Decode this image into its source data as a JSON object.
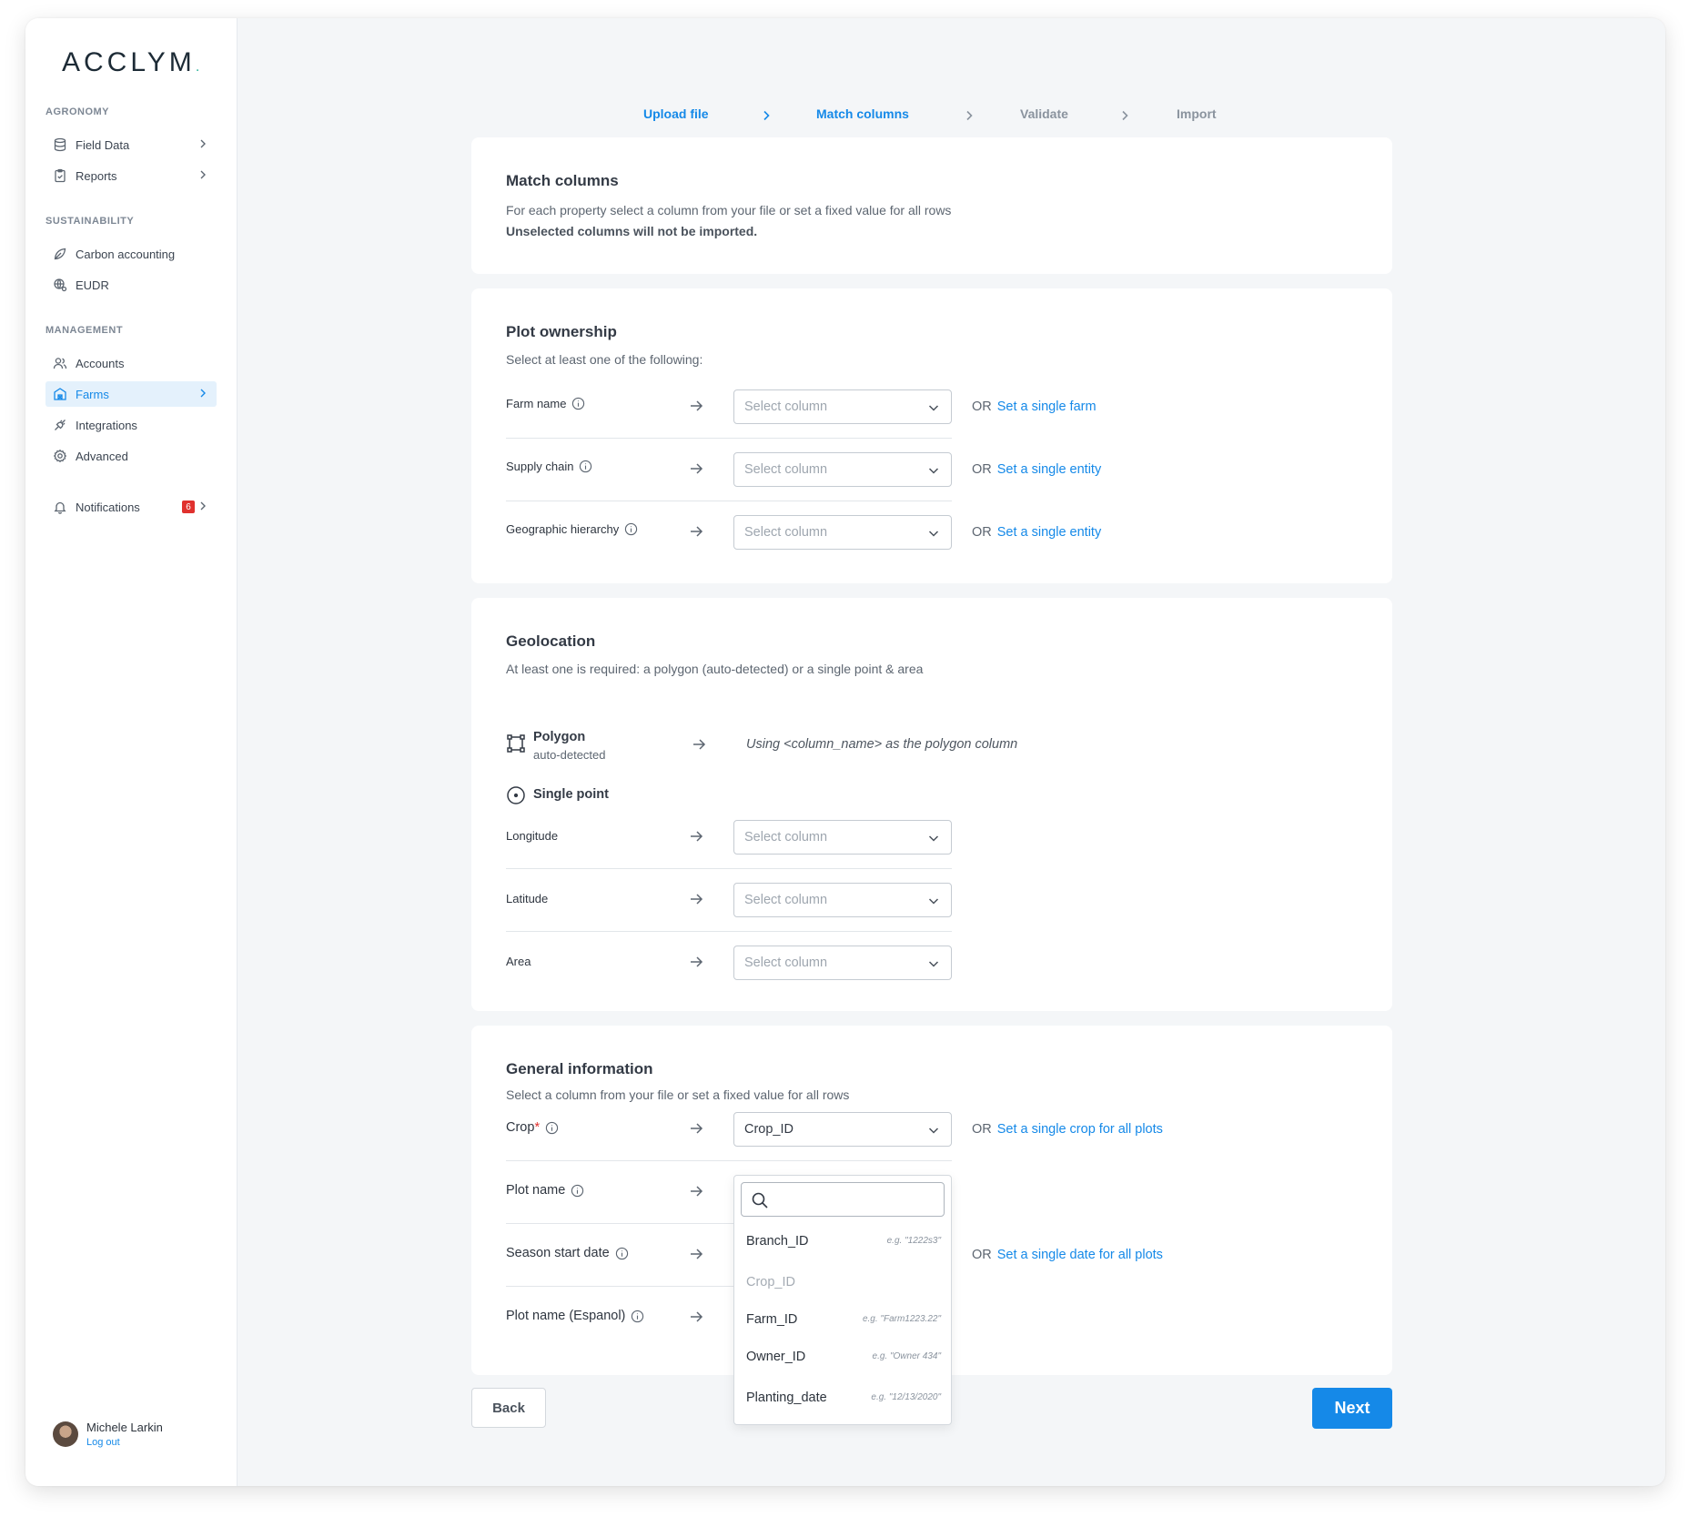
{
  "app": {
    "logo": "ACCLYM",
    "logo_dot": "."
  },
  "sidebar": {
    "sections": [
      {
        "title": "AGRONOMY"
      },
      {
        "title": "SUSTAINABILITY"
      },
      {
        "title": "MANAGEMENT"
      }
    ],
    "items": [
      {
        "label": "Field Data",
        "icon": "database-icon"
      },
      {
        "label": "Reports",
        "icon": "clipboard-icon"
      },
      {
        "label": "Carbon accounting",
        "icon": "leaf-icon"
      },
      {
        "label": "EUDR",
        "icon": "globe-icon"
      },
      {
        "label": "Accounts",
        "icon": "users-icon"
      },
      {
        "label": "Farms",
        "icon": "farm-icon",
        "active": true
      },
      {
        "label": "Integrations",
        "icon": "plug-icon"
      },
      {
        "label": "Advanced",
        "icon": "gear-icon"
      },
      {
        "label": "Notifications",
        "icon": "bell-icon",
        "badge": "6"
      }
    ],
    "user": {
      "name": "Michele Larkin",
      "logout": "Log out"
    }
  },
  "stepper": {
    "steps": [
      {
        "label": "Upload file",
        "state": "done"
      },
      {
        "label": "Match columns",
        "state": "current"
      },
      {
        "label": "Validate",
        "state": "todo"
      },
      {
        "label": "Import",
        "state": "todo"
      }
    ]
  },
  "intro": {
    "title": "Match columns",
    "subtitle": "For each property select a column from your file or set a fixed value for all rows",
    "note": "Unselected columns will not be imported."
  },
  "ownership": {
    "title": "Plot ownership",
    "subtitle": "Select at least one of the following:",
    "rows": [
      {
        "label": "Farm name",
        "placeholder": "Select column",
        "or": "OR",
        "link": "Set a single farm"
      },
      {
        "label": "Supply chain",
        "placeholder": "Select column",
        "or": "OR",
        "link": "Set a single entity"
      },
      {
        "label": "Geographic hierarchy",
        "placeholder": "Select column",
        "or": "OR",
        "link": "Set a single entity"
      }
    ]
  },
  "geolocation": {
    "title": "Geolocation",
    "subtitle": "At least one is required: a polygon (auto-detected) or a single point & area",
    "polygon": {
      "title": "Polygon",
      "sub": "auto-detected",
      "note": "Using <column_name> as the polygon column"
    },
    "single_point": {
      "title": "Single point"
    },
    "rows": [
      {
        "label": "Longitude",
        "placeholder": "Select column"
      },
      {
        "label": "Latitude",
        "placeholder": "Select column"
      },
      {
        "label": "Area",
        "placeholder": "Select column"
      }
    ]
  },
  "general": {
    "title": "General information",
    "subtitle": "Select a column from your file or set a fixed value for all rows",
    "rows": [
      {
        "label": "Crop",
        "required": "*",
        "value": "Crop_ID",
        "or": "OR",
        "link": "Set a single crop for all plots"
      },
      {
        "label": "Plot name"
      },
      {
        "label": "Season start date",
        "or": "OR",
        "link": "Set a single date for all plots"
      },
      {
        "label": "Plot name (Espanol)"
      }
    ]
  },
  "dropdown": {
    "search_placeholder": "",
    "options": [
      {
        "label": "Branch_ID",
        "example": "e.g. \"1222s3\""
      },
      {
        "label": "Crop_ID",
        "example": "",
        "disabled": true
      },
      {
        "label": "Farm_ID",
        "example": "e.g. \"Farm1223.22\""
      },
      {
        "label": "Owner_ID",
        "example": "e.g. \"Owner 434\""
      },
      {
        "label": "Planting_date",
        "example": "e.g. \"12/13/2020\""
      }
    ]
  },
  "actions": {
    "back": "Back",
    "next": "Next"
  },
  "colors": {
    "accent": "#1589e8",
    "badge": "#e0312e",
    "brand_dot": "#2bb39a"
  }
}
